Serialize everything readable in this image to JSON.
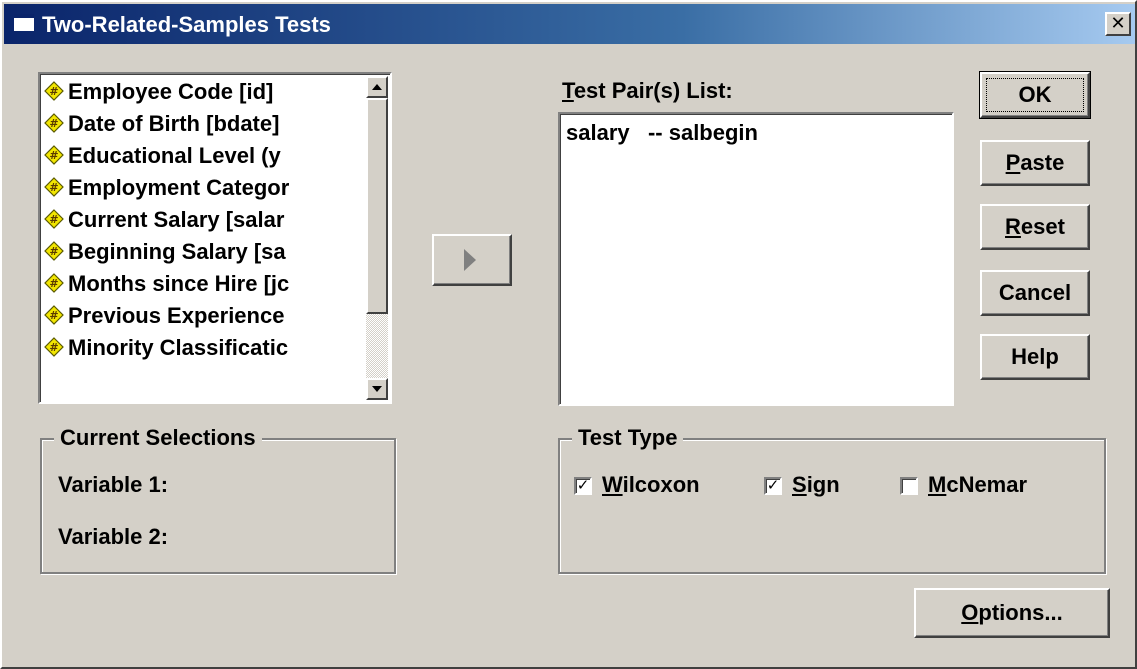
{
  "window": {
    "title": "Two-Related-Samples Tests",
    "close_glyph": "✕"
  },
  "variables": [
    {
      "label": "Employee Code [id]",
      "icon": "numeric-variable-icon"
    },
    {
      "label": "Date of Birth [bdate]",
      "icon": "numeric-variable-icon"
    },
    {
      "label": "Educational Level (y",
      "icon": "numeric-variable-icon"
    },
    {
      "label": "Employment Categor",
      "icon": "numeric-variable-icon"
    },
    {
      "label": "Current Salary [salar",
      "icon": "numeric-variable-icon"
    },
    {
      "label": "Beginning Salary [sa",
      "icon": "numeric-variable-icon"
    },
    {
      "label": "Months since Hire [jc",
      "icon": "numeric-variable-icon"
    },
    {
      "label": "Previous Experience",
      "icon": "numeric-variable-icon"
    },
    {
      "label": "Minority Classificatic",
      "icon": "numeric-variable-icon"
    }
  ],
  "test_pairs": {
    "label_first": "T",
    "label_rest": "est Pair(s) List:",
    "items": [
      "salary   -- salbegin"
    ]
  },
  "buttons": {
    "ok": "OK",
    "paste_first": "P",
    "paste_rest": "aste",
    "reset_first": "R",
    "reset_rest": "eset",
    "cancel": "Cancel",
    "help": "Help",
    "options_first": "O",
    "options_rest": "ptions..."
  },
  "current_selections": {
    "title": "Current Selections",
    "variable1_label": "Variable 1:",
    "variable2_label": "Variable 2:"
  },
  "test_type": {
    "title": "Test Type",
    "options": [
      {
        "first": "W",
        "rest": "ilcoxon",
        "checked": true
      },
      {
        "first": "S",
        "rest": "ign",
        "checked": true
      },
      {
        "first": "M",
        "rest": "cNemar",
        "checked": false
      }
    ],
    "check_glyph": "✓"
  },
  "colors": {
    "face": "#d4d0c8",
    "title_start": "#0a246a",
    "title_end": "#a6caf0",
    "icon_fill": "#f2e600"
  }
}
